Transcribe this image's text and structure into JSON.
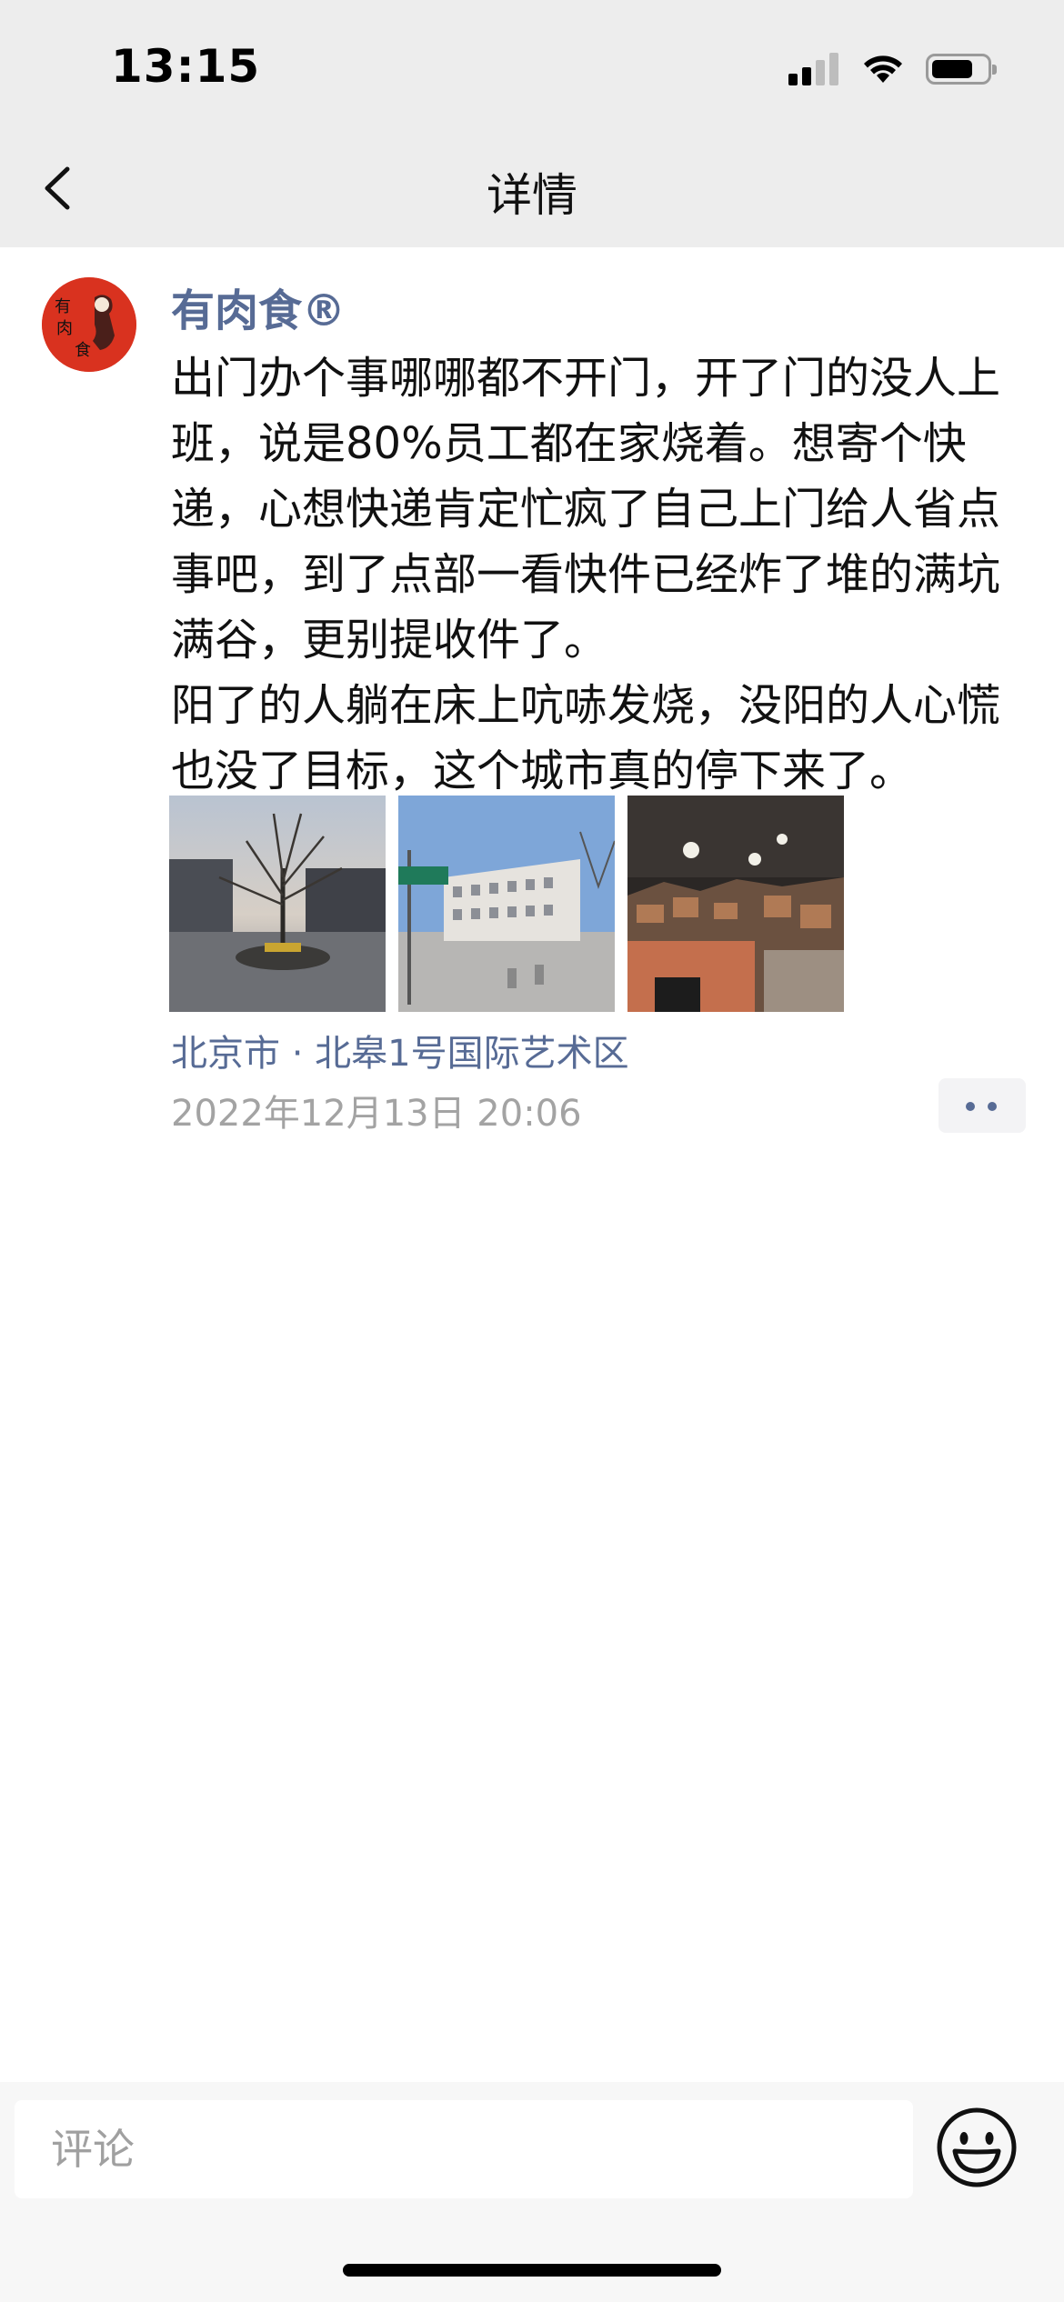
{
  "status_bar": {
    "time": "13:15"
  },
  "nav": {
    "title": "详情",
    "back_icon": "chevron-left-icon"
  },
  "post": {
    "author": "有肉食®",
    "avatar_text": "有肉食",
    "text": "出门办个事哪哪都不开门，开了门的没人上班，说是80%员工都在家烧着。想寄个快递，心想快递肯定忙疯了自己上门给人省点事吧，到了点部一看快件已经炸了堆的满坑满谷，更别提收件了。\n阳了的人躺在床上吭哧发烧，没阳的人心慌也没了目标，这个城市真的停下来了。",
    "photos": [
      {
        "icon": "photo-plaza-tree"
      },
      {
        "icon": "photo-street-building"
      },
      {
        "icon": "photo-parcel-pile-night"
      }
    ],
    "location": "北京市 · 北皋1号国际艺术区",
    "timestamp": "2022年12月13日 20:06",
    "more_icon": "more-dots-icon"
  },
  "comment_bar": {
    "placeholder": "评论",
    "emoji_icon": "emoji-smile-icon"
  },
  "colors": {
    "link_blue": "#576b95",
    "top_bg": "#ededed",
    "avatar_red": "#d9321f"
  }
}
